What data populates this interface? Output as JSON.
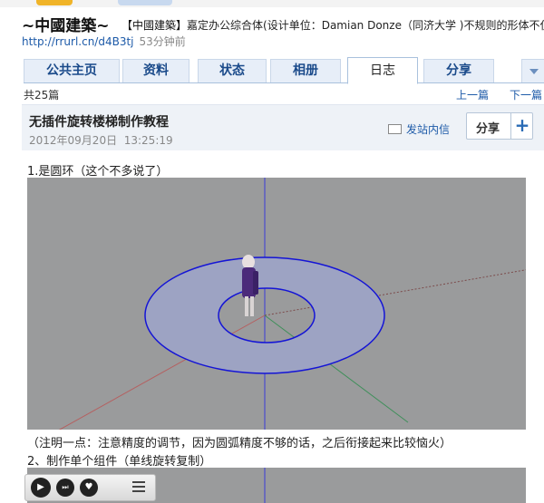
{
  "header": {
    "site_title": "~中國建築~",
    "status_tag": "【中國建築】",
    "status_text": "嘉定办公综合体(设计单位：Damian Donze（同济大学 )不规则的形体不仅",
    "url": "http://rrurl.cn/d4B3tj",
    "time_ago": "53分钟前"
  },
  "tabs": [
    {
      "label": "公共主页"
    },
    {
      "label": "资料"
    },
    {
      "label": "状态"
    },
    {
      "label": "相册"
    },
    {
      "label": "日志"
    },
    {
      "label": "分享"
    }
  ],
  "pager": {
    "count": "共25篇",
    "prev": "上一篇",
    "next": "下一篇"
  },
  "post": {
    "title": "无插件旋转楼梯制作教程",
    "date": "2012年09月20日",
    "time": "13:25:19",
    "message_link": "发站内信",
    "share_label": "分享",
    "share_plus": "+"
  },
  "content": {
    "step1": "1.是圆环（这个不多说了）",
    "note": "（注明一点：注意精度的调节，因为圆弧精度不够的话，之后衔接起来比较恼火）",
    "step2": "2、制作单个组件（单线旋转复制）"
  },
  "colors": {
    "link": "#1d5aa8",
    "tab_bg": "#e7eef8",
    "viewport_bg": "#9a9b9c",
    "ring_fill": "#9da3c3",
    "ring_stroke": "#1414d6"
  },
  "icons": {
    "envelope": "envelope-icon",
    "play": "play-icon",
    "next": "next-track-icon",
    "like": "heart-icon",
    "playlist": "playlist-icon"
  }
}
